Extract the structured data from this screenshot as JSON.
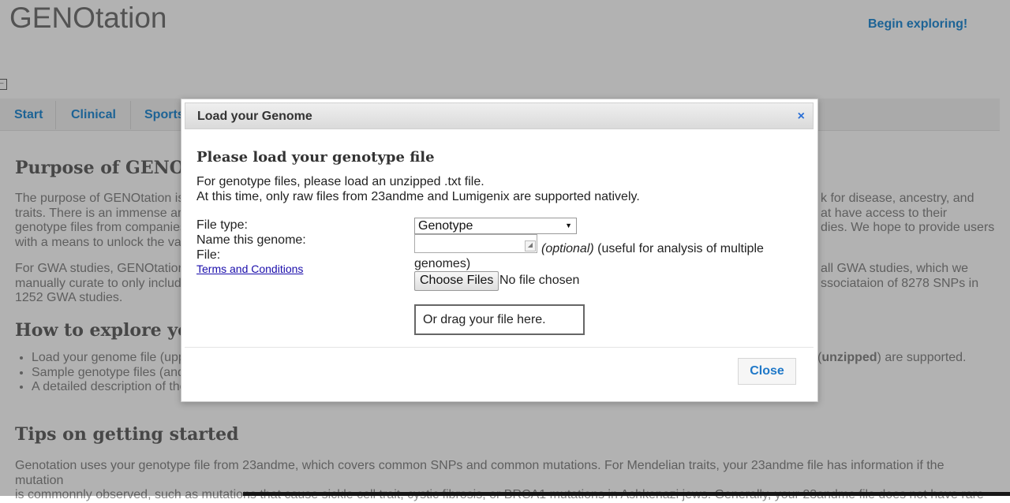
{
  "site": {
    "title": "GENOtation",
    "begin_label": "Begin exploring!",
    "tabs": [
      "Start",
      "Clinical",
      "Sports"
    ]
  },
  "background": {
    "purpose_heading": "Purpose of GENO",
    "purpose_text": "The purpose of GENOtation is",
    "purpose_lines": [
      "traits. There is an immense am",
      "genotype files from companies",
      "with a means to unlock the vas"
    ],
    "purpose_right": [
      "k for disease, ancestry, and",
      "at have access to their",
      "dies. We hope to provide users"
    ],
    "gwa_lines": [
      "For GWA studies, GENOtation",
      "manually curate to only include",
      "1252 GWA studies."
    ],
    "gwa_right": [
      "all GWA studies, which we",
      "ssociataion of 8278 SNPs in"
    ],
    "explore_heading": "How to explore yo",
    "bullets": [
      "Load your genome file (upp",
      "Sample genotype files (and",
      "A detailed description of the"
    ],
    "bullet_right_pre": "(",
    "bullet_right_bold": "unzipped",
    "bullet_right_post": ") are supported.",
    "tips_heading": "Tips on getting started",
    "tips_lines": [
      "Genotation uses your genotype file from 23andme, which covers common SNPs and common mutations. For Mendelian traits, your 23andme file has information if the mutation",
      "is commonnly observed, such as mutations that cause sickle cell trait, cystic fibrosis, or BRCA1 mutations in Ashkenazi jews. Generally, your 23andme file does not have rare"
    ]
  },
  "modal": {
    "title": "Load your Genome",
    "close_x": "×",
    "heading": "Please load your genotype file",
    "line1": "For genotype files, please load an unzipped .txt file.",
    "line2": "At this time, only raw files from 23andme and Lumigenix are supported natively.",
    "label_file_type": "File type:",
    "label_name": "Name this genome:",
    "label_file": "File:",
    "terms_link": "Terms and Conditions",
    "file_type_selected": "Genotype",
    "optional_italic": "(optional)",
    "optional_note": " (useful for analysis of multiple",
    "optional_note_2": "genomes)",
    "choose_files": "Choose Files",
    "no_file": "No file chosen",
    "drop_zone": "Or drag your file here.",
    "close_button": "Close"
  }
}
